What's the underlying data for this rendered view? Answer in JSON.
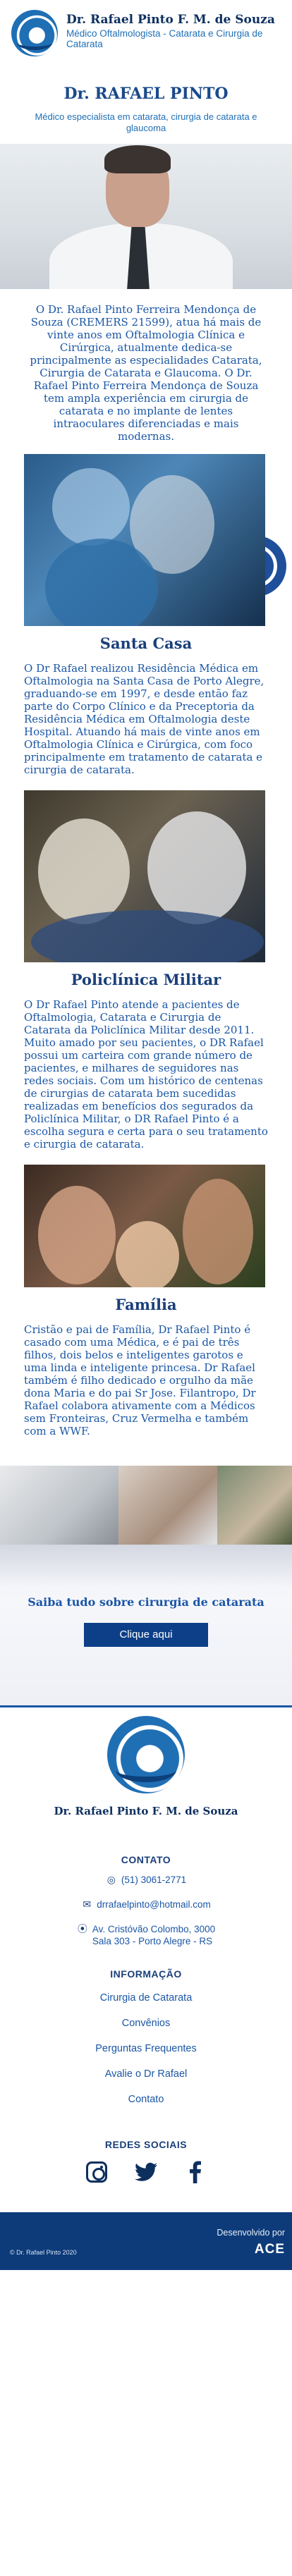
{
  "header": {
    "brand_name": "Dr. Rafael Pinto F. M. de Souza",
    "brand_subtitle": "Médico Oftalmologista - Catarata e Cirurgia de Catarata"
  },
  "intro": {
    "title": "Dr. RAFAEL PINTO",
    "subtitle": "Médico especialista em catarata, cirurgia de catarata e glaucoma",
    "text": "O Dr. Rafael Pinto Ferreira Mendonça de Souza (CREMERS 21599), atua há mais de vinte anos em Oftalmologia Clínica e Cirúrgica, atualmente dedica-se principalmente as especialidades Catarata, Cirurgia de Catarata e Glaucoma. O Dr. Rafael Pinto Ferreira Mendonça de Souza tem ampla experiência em cirurgia de catarata e no implante de lentes intraoculares diferenciadas e mais modernas."
  },
  "sections": [
    {
      "title": "Santa Casa",
      "text": "O Dr Rafael realizou Residência Médica em Oftalmologia na Santa Casa de Porto Alegre, graduando-se em 1997, e desde então faz parte do Corpo Clínico e da Preceptoria da Residência Médica em Oftalmologia deste Hospital. Atuando há mais de vinte anos em Oftalmologia Clínica e Cirúrgica, com foco principalmente em tratamento de catarata e cirurgia de catarata."
    },
    {
      "title": "Policlínica Militar",
      "text": "O Dr Rafael Pinto atende a pacientes de Oftalmologia, Catarata e Cirurgia de Catarata da Policlínica Militar desde 2011. Muito amado por seu pacientes, o DR Rafael possui um carteira com grande número de pacientes, e milhares de seguidores nas redes sociais. Com um histórico de centenas de cirurgias de catarata bem sucedidas realizadas em benefícios dos segurados da Policlínica Militar, o DR Rafael Pinto é a escolha segura e certa para o seu tratamento e cirurgia de catarata."
    },
    {
      "title": "Família",
      "text": "Cristão e pai de Família, Dr Rafael Pinto é casado com uma Médica, e é pai de três filhos, dois belos e inteligentes garotos e uma linda e inteligente princesa. Dr Rafael também é filho dedicado e orgulho da mãe dona Maria e do pai Sr Jose. Filantropo, Dr Rafael colabora ativamente com a Médicos sem Fronteiras, Cruz Vermelha e também com a WWF."
    }
  ],
  "cta": {
    "title": "Saiba tudo sobre cirurgia de catarata",
    "button": "Clique aqui"
  },
  "footer": {
    "brand_name": "Dr. Rafael Pinto F. M. de Souza",
    "contact_heading": "CONTATO",
    "phone": "(51) 3061-2771",
    "email": "drrafaelpinto@hotmail.com",
    "address_line1": "Av. Cristóvão Colombo, 3000",
    "address_line2": "Sala 303 - Porto Alegre - RS",
    "info_heading": "INFORMAÇÃO",
    "info_links": [
      "Cirurgia de Catarata",
      "Convênios",
      "Perguntas Frequentes",
      "Avalie o Dr Rafael",
      "Contato"
    ],
    "social_heading": "REDES SOCIAIS",
    "social_icons": [
      "instagram-icon",
      "twitter-icon",
      "facebook-icon"
    ],
    "copyright": "© Dr. Rafael Pinto 2020",
    "developer_label": "Desenvolvido por",
    "developer_brand": "ACE"
  },
  "colors": {
    "primary": "#1a56a6",
    "dark_blue": "#0d3b7a",
    "button": "#0d3f88"
  }
}
